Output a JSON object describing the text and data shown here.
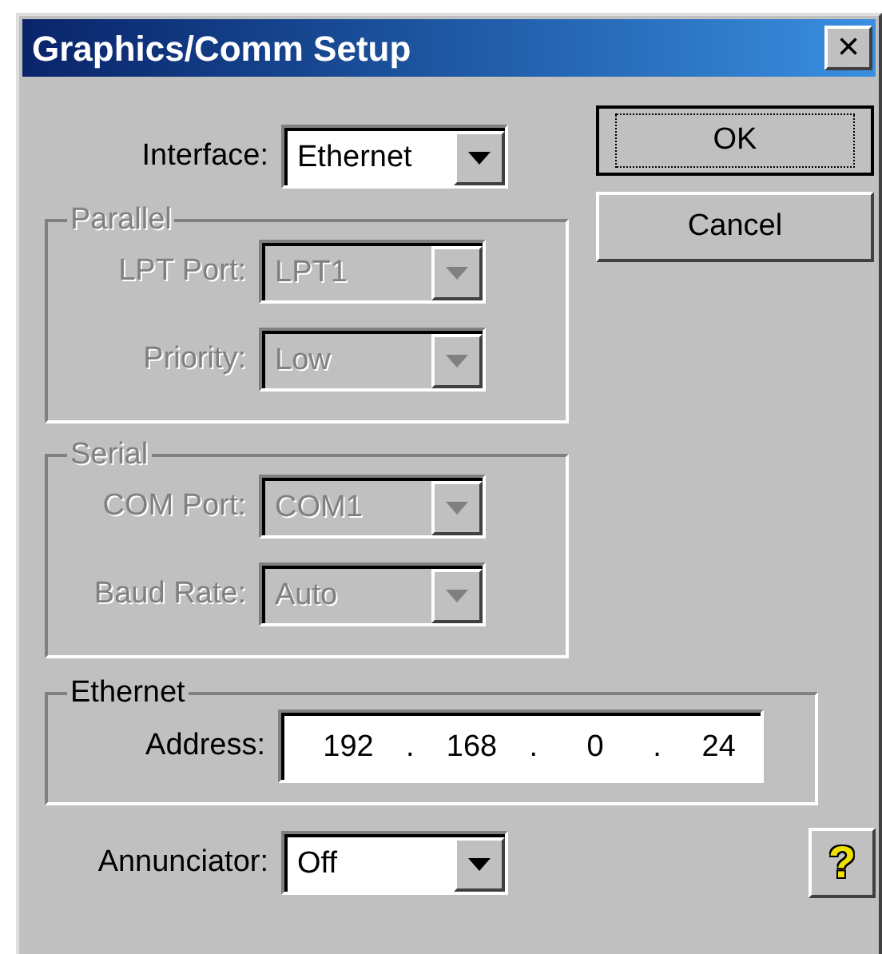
{
  "window": {
    "title": "Graphics/Comm Setup",
    "close": "×"
  },
  "interface": {
    "label": "Interface:",
    "value": "Ethernet",
    "disabled": false
  },
  "buttons": [
    {
      "label": "OK",
      "focused": true
    },
    {
      "label": "Cancel",
      "focused": false
    }
  ],
  "groups": [
    {
      "title": "Parallel",
      "disabled": true,
      "fields": [
        {
          "label": "LPT Port:",
          "value": "LPT1"
        },
        {
          "label": "Priority:",
          "value": "Low"
        }
      ]
    },
    {
      "title": "Serial",
      "disabled": true,
      "fields": [
        {
          "label": "COM Port:",
          "value": "COM1"
        },
        {
          "label": "Baud Rate:",
          "value": "Auto"
        }
      ]
    }
  ],
  "ethernet": {
    "title": "Ethernet",
    "label": "Address:",
    "octets": [
      "192",
      "168",
      "0",
      "24"
    ],
    "separators": [
      ".",
      ".",
      "."
    ]
  },
  "annunciator": {
    "label": "Annunciator:",
    "value": "Off",
    "disabled": false
  },
  "help": {
    "label": "?"
  }
}
